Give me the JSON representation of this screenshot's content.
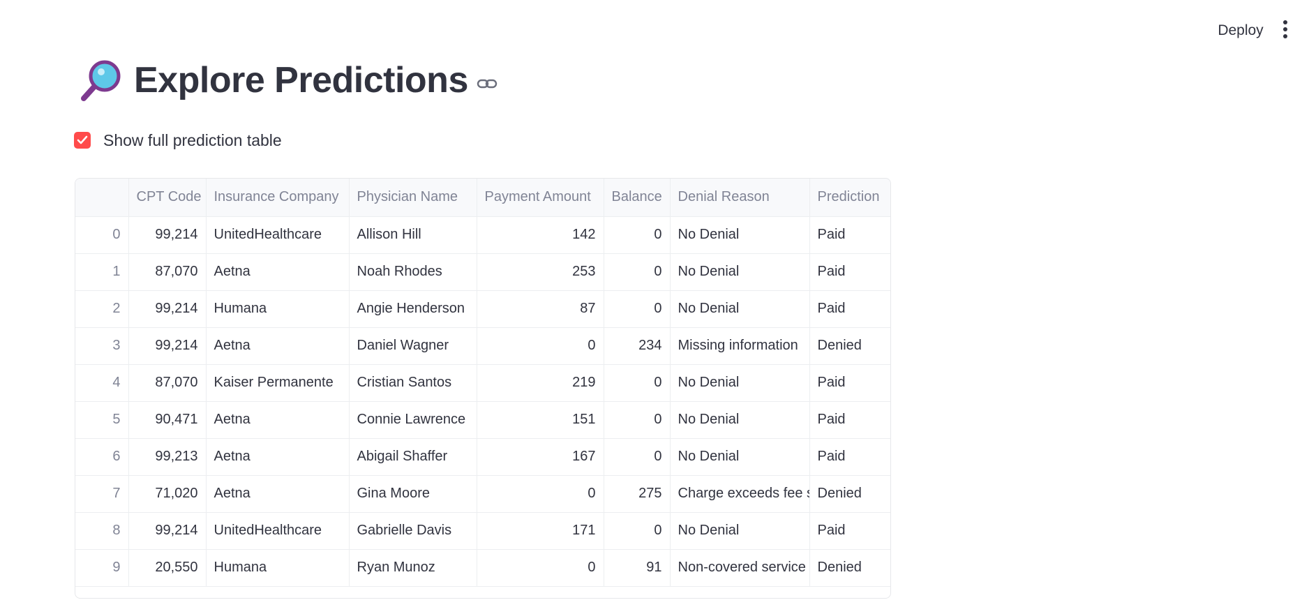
{
  "header": {
    "deploy_label": "Deploy",
    "menu_icon": "kebab-menu-icon"
  },
  "page": {
    "title": "Explore Predictions",
    "title_icon": "magnifying-glass-icon",
    "anchor_icon": "link-icon"
  },
  "checkbox": {
    "label": "Show full prediction table",
    "checked": true,
    "color": "#ff4b4b"
  },
  "table": {
    "columns": [
      "",
      "CPT Code",
      "Insurance Company",
      "Physician Name",
      "Payment Amount",
      "Balance",
      "Denial Reason",
      "Prediction"
    ],
    "rows": [
      [
        "0",
        "99,214",
        "UnitedHealthcare",
        "Allison Hill",
        "142",
        "0",
        "No Denial",
        "Paid"
      ],
      [
        "1",
        "87,070",
        "Aetna",
        "Noah Rhodes",
        "253",
        "0",
        "No Denial",
        "Paid"
      ],
      [
        "2",
        "99,214",
        "Humana",
        "Angie Henderson",
        "87",
        "0",
        "No Denial",
        "Paid"
      ],
      [
        "3",
        "99,214",
        "Aetna",
        "Daniel Wagner",
        "0",
        "234",
        "Missing information",
        "Denied"
      ],
      [
        "4",
        "87,070",
        "Kaiser Permanente",
        "Cristian Santos",
        "219",
        "0",
        "No Denial",
        "Paid"
      ],
      [
        "5",
        "90,471",
        "Aetna",
        "Connie Lawrence",
        "151",
        "0",
        "No Denial",
        "Paid"
      ],
      [
        "6",
        "99,213",
        "Aetna",
        "Abigail Shaffer",
        "167",
        "0",
        "No Denial",
        "Paid"
      ],
      [
        "7",
        "71,020",
        "Aetna",
        "Gina Moore",
        "0",
        "275",
        "Charge exceeds fee schedule",
        "Denied"
      ],
      [
        "8",
        "99,214",
        "UnitedHealthcare",
        "Gabrielle Davis",
        "171",
        "0",
        "No Denial",
        "Paid"
      ],
      [
        "9",
        "20,550",
        "Humana",
        "Ryan Munoz",
        "0",
        "91",
        "Non-covered service",
        "Denied"
      ]
    ]
  }
}
